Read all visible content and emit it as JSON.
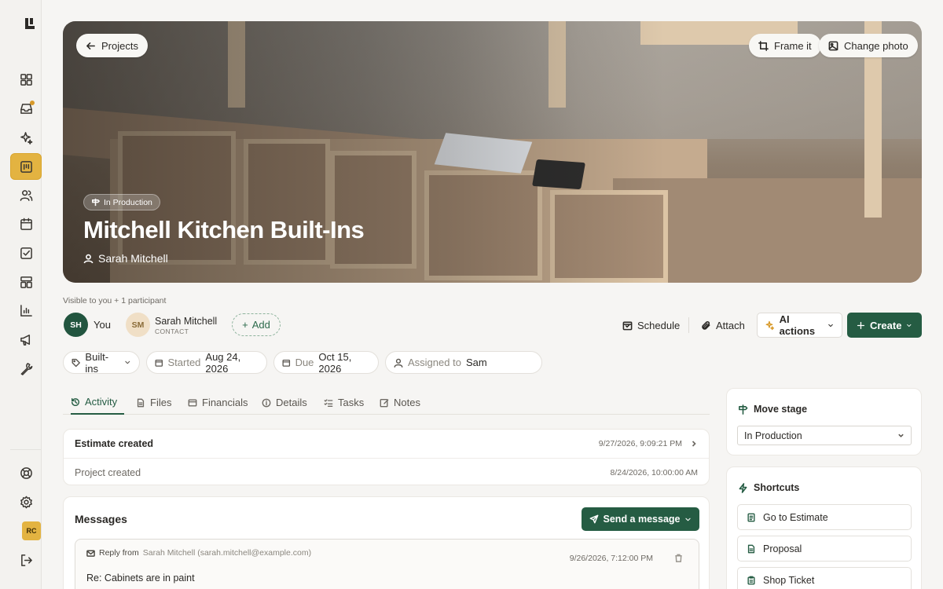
{
  "app": {
    "logo": "logo-mark",
    "user_initials": "RC"
  },
  "sidebar": {
    "items": [
      {
        "icon": "dashboard-icon"
      },
      {
        "icon": "inbox-icon",
        "has_notification": true
      },
      {
        "icon": "sparkles-icon"
      },
      {
        "icon": "projects-icon",
        "active": true
      },
      {
        "icon": "people-icon"
      },
      {
        "icon": "calendar-icon"
      },
      {
        "icon": "tasks-icon"
      },
      {
        "icon": "layout-icon"
      },
      {
        "icon": "reports-icon"
      },
      {
        "icon": "megaphone-icon"
      },
      {
        "icon": "wrench-icon"
      }
    ],
    "bottom": [
      {
        "icon": "help-icon"
      },
      {
        "icon": "settings-icon"
      },
      {
        "icon": "logout-icon"
      }
    ]
  },
  "hero": {
    "back_label": "Projects",
    "frame_label": "Frame it",
    "change_photo_label": "Change photo",
    "stage_badge": "In Production",
    "title": "Mitchell Kitchen Built-Ins",
    "client": "Sarah Mitchell"
  },
  "participants": {
    "visibility": "Visible to you + 1 participant",
    "me": {
      "initials": "SH",
      "label": "You"
    },
    "contact": {
      "initials": "SM",
      "name": "Sarah Mitchell",
      "role": "CONTACT"
    },
    "add_label": "Add"
  },
  "actions": {
    "schedule": "Schedule",
    "attach": "Attach",
    "ai": "AI actions",
    "create": "Create"
  },
  "meta": {
    "category": "Built-ins",
    "started_label": "Started",
    "started_value": "Aug 24, 2026",
    "due_label": "Due",
    "due_value": "Oct 15, 2026",
    "assigned_label": "Assigned to",
    "assigned_value": "Sam"
  },
  "tabs": [
    {
      "label": "Activity",
      "active": true
    },
    {
      "label": "Files"
    },
    {
      "label": "Financials"
    },
    {
      "label": "Details"
    },
    {
      "label": "Tasks"
    },
    {
      "label": "Notes"
    }
  ],
  "activity": [
    {
      "label": "Estimate created",
      "time": "9/27/2026, 9:09:21 PM"
    },
    {
      "label": "Project created",
      "time": "8/24/2026, 10:00:00 AM"
    }
  ],
  "messages": {
    "title": "Messages",
    "send_label": "Send a message",
    "items": [
      {
        "prefix": "Reply from",
        "from": "Sarah Mitchell (sarah.mitchell@example.com)",
        "time": "9/26/2026, 7:12:00 PM",
        "subject": "Re: Cabinets are in paint"
      }
    ]
  },
  "stage_panel": {
    "title": "Move stage",
    "value": "In Production"
  },
  "shortcuts": {
    "title": "Shortcuts",
    "items": [
      "Go to Estimate",
      "Proposal",
      "Shop Ticket"
    ]
  },
  "colors": {
    "brand_green": "#255c43",
    "accent_gold": "#e3b341"
  }
}
